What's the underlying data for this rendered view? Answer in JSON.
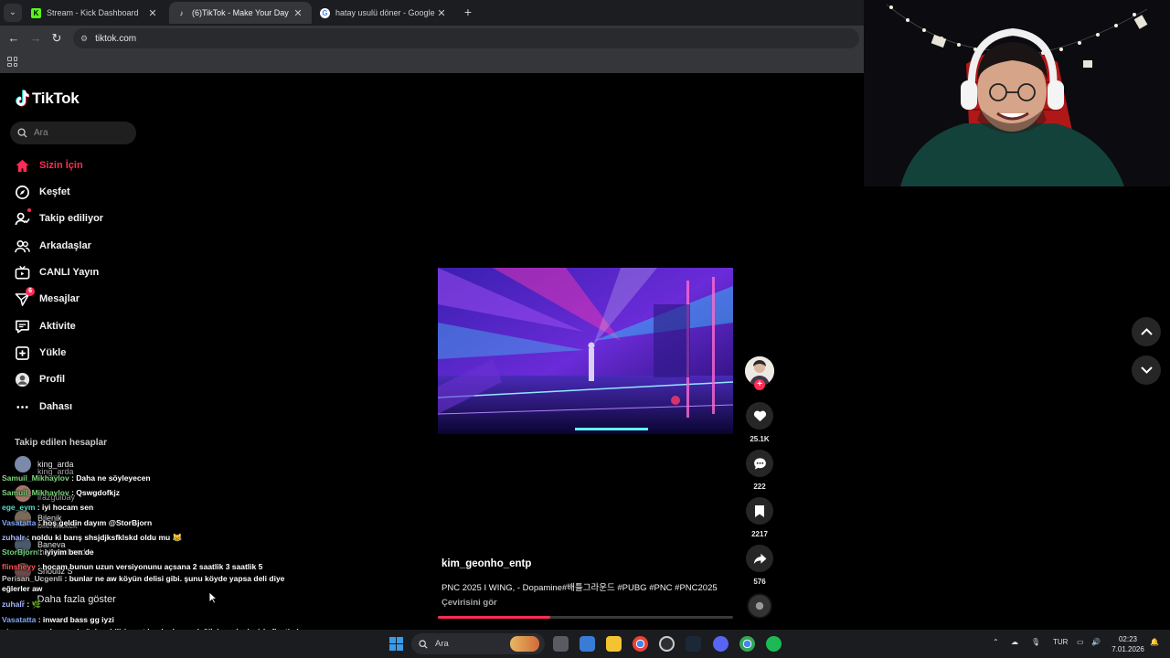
{
  "browser": {
    "tabs": [
      {
        "title": "Stream - Kick Dashboard",
        "active": false,
        "favicon_color": "#53fc18"
      },
      {
        "title": "(6)TikTok - Make Your Day",
        "active": true,
        "favicon_color": "#ffffff"
      },
      {
        "title": "hatay usulü döner - Google'da",
        "active": false,
        "favicon_color": "#4285f4"
      }
    ],
    "url": "tiktok.com"
  },
  "tiktok": {
    "logo": "TikTok",
    "search_placeholder": "Ara",
    "nav": [
      {
        "label": "Sizin İçin",
        "icon": "home-icon",
        "active": true
      },
      {
        "label": "Keşfet",
        "icon": "compass-icon"
      },
      {
        "label": "Takip ediliyor",
        "icon": "following-icon"
      },
      {
        "label": "Arkadaşlar",
        "icon": "friends-icon"
      },
      {
        "label": "CANLI Yayın",
        "icon": "live-icon"
      },
      {
        "label": "Mesajlar",
        "icon": "messages-icon",
        "badge": "6"
      },
      {
        "label": "Aktivite",
        "icon": "activity-icon"
      },
      {
        "label": "Yükle",
        "icon": "upload-icon"
      },
      {
        "label": "Profil",
        "icon": "profile-icon"
      },
      {
        "label": "Dahası",
        "icon": "more-icon"
      }
    ],
    "following_title": "Takip edilen hesaplar",
    "following": [
      {
        "name": "king_arda",
        "sub": "king_arda"
      },
      {
        "name": "irazguibay",
        "sub": ""
      },
      {
        "name": "Bilenik",
        "sub": "bilenikckck"
      },
      {
        "name": "Baneva",
        "sub": "thebanebande"
      },
      {
        "name": "Shoutiz S",
        "sub": "x"
      }
    ],
    "show_more": "Daha fazla göster",
    "post": {
      "creator": "kim_geonho_entp",
      "caption": "PNC 2025 I WING, - Dopamine#배틀그라운드 #PUBG #PNC #PNC2025",
      "translate": "Çevirisini gör",
      "progress": 0.38,
      "likes": "25.1K",
      "comments": "222",
      "saves": "2217",
      "shares": "576"
    }
  },
  "chat": [
    {
      "user": "Samuil_Mikhaylov",
      "color": "#7cd67c",
      "text": "Daha ne söyleyecen"
    },
    {
      "user": "Samuil_Mikhaylov",
      "color": "#7cd67c",
      "text": "Qswgdofkjz"
    },
    {
      "user": "ege_eym",
      "color": "#4fe0d0",
      "text": "iyi hocam sen"
    },
    {
      "user": "Vasatatta",
      "color": "#7ea8f8",
      "text": "hoş geldin dayım @StorBjorn"
    },
    {
      "user": "zuhalr",
      "color": "#a9b7ff",
      "text": "noldu ki barış shsjdjksfklskd oldu mu 😹"
    },
    {
      "user": "StorBjorn",
      "color": "#6ad97a",
      "text": "iyiyim ben de"
    },
    {
      "user": "flinsheyy",
      "color": "#ff5050",
      "text": "hocam bunun uzun versiyonunu açsana 2 saatlik 3 saatlik 5"
    },
    {
      "user": "Perisan_Ucgenli",
      "color": "#c0c0c0",
      "text": "bunlar ne aw köyün delisi gibi. şunu köyde yapsa deli diye eğlerler aw"
    },
    {
      "user": "zuhalr",
      "color": "#a9b7ff",
      "text": "🌿"
    },
    {
      "user": "Vasatatta",
      "color": "#7ea8f8",
      "text": "inward bass gg iyzi"
    },
    {
      "user": "gizzeyseep",
      "color": "#8fd0ff",
      "text": "her şeyi söyleyebilirim artık arkadaşım değilsinnn (çok çirkefleştim)"
    }
  ],
  "taskbar": {
    "search_placeholder": "Ara",
    "language": "TUR",
    "time": "02:23",
    "date": "7.01.2026"
  }
}
